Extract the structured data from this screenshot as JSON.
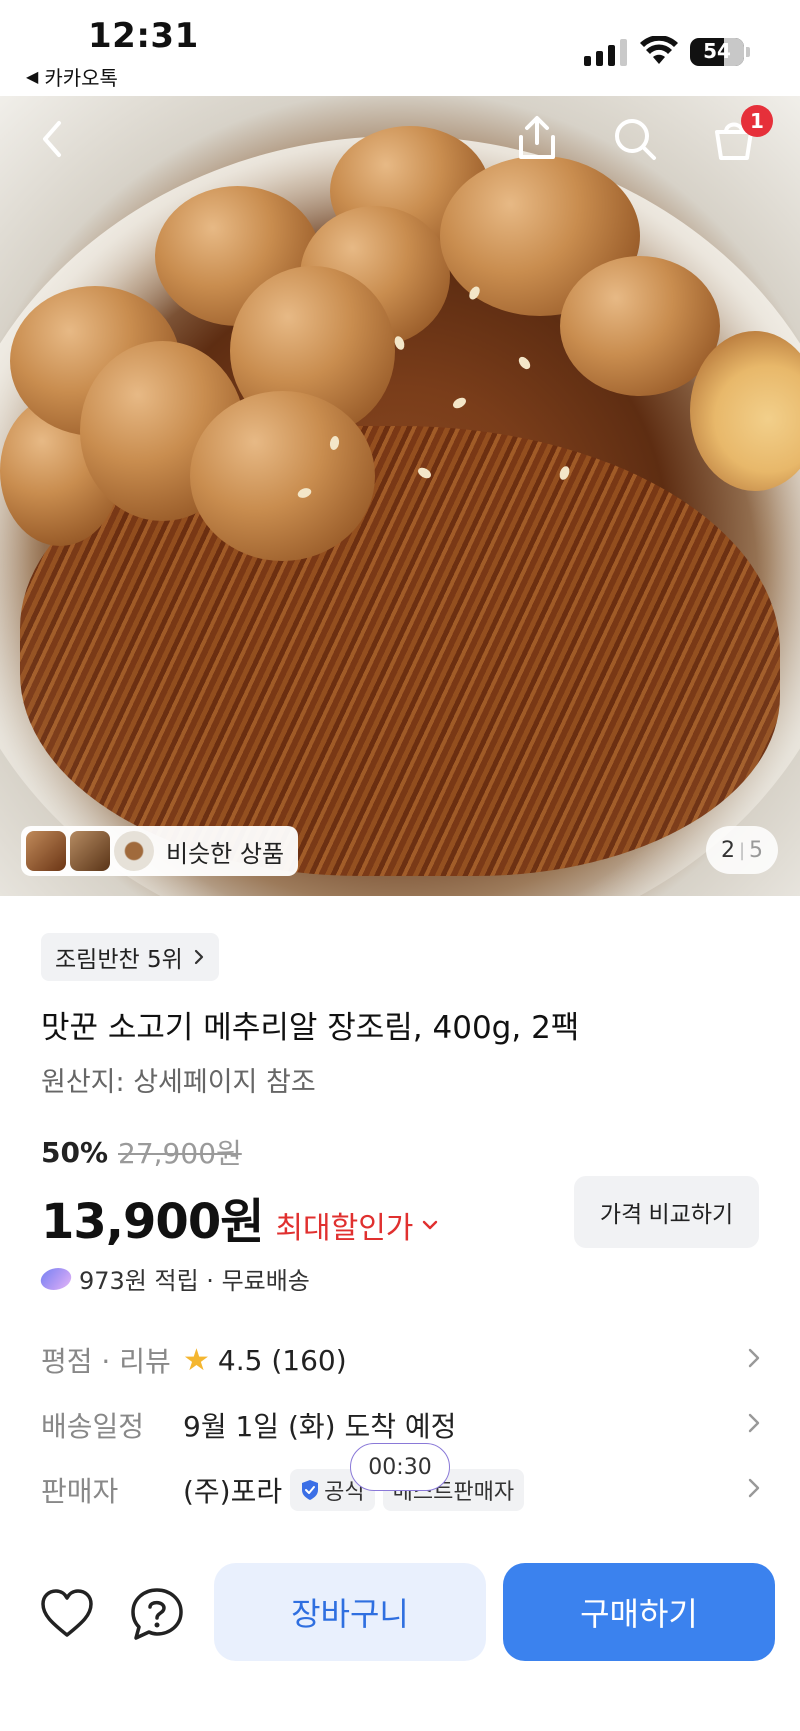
{
  "status_bar": {
    "time": "12:31",
    "back_app_label": "카카오톡",
    "battery": "54"
  },
  "hero": {
    "cart_badge": "1",
    "similar_label": "비슷한 상품",
    "page_current": "2",
    "page_sep": "|",
    "page_total": "5"
  },
  "product": {
    "rank_chip": "조림반찬 5위",
    "title": "맛꾼 소고기 메추리알 장조림, 400g, 2팩",
    "origin": "원산지: 상세페이지 참조",
    "discount_pct": "50%",
    "original_price": "27,900원",
    "price": "13,900원",
    "best_price_label": "최대할인가",
    "compare_button": "가격 비교하기",
    "points_text": "973원 적립 · 무료배송"
  },
  "info": {
    "rating_key": "평점 · 리뷰",
    "rating_value": "4.5 (160)",
    "shipping_key": "배송일정",
    "shipping_value": "9월 1일 (화) 도착 예정",
    "seller_key": "판매자",
    "seller_value": "(주)포라",
    "seller_tag_official": "공식",
    "seller_tag_best": "베스트판매자"
  },
  "timer": "00:30",
  "bottom": {
    "cart_button": "장바구니",
    "buy_button": "구매하기"
  },
  "colors": {
    "accent_blue": "#3b82ee",
    "sale_red": "#e0302f",
    "badge_red": "#e6303a",
    "star_yellow": "#f4b630"
  }
}
